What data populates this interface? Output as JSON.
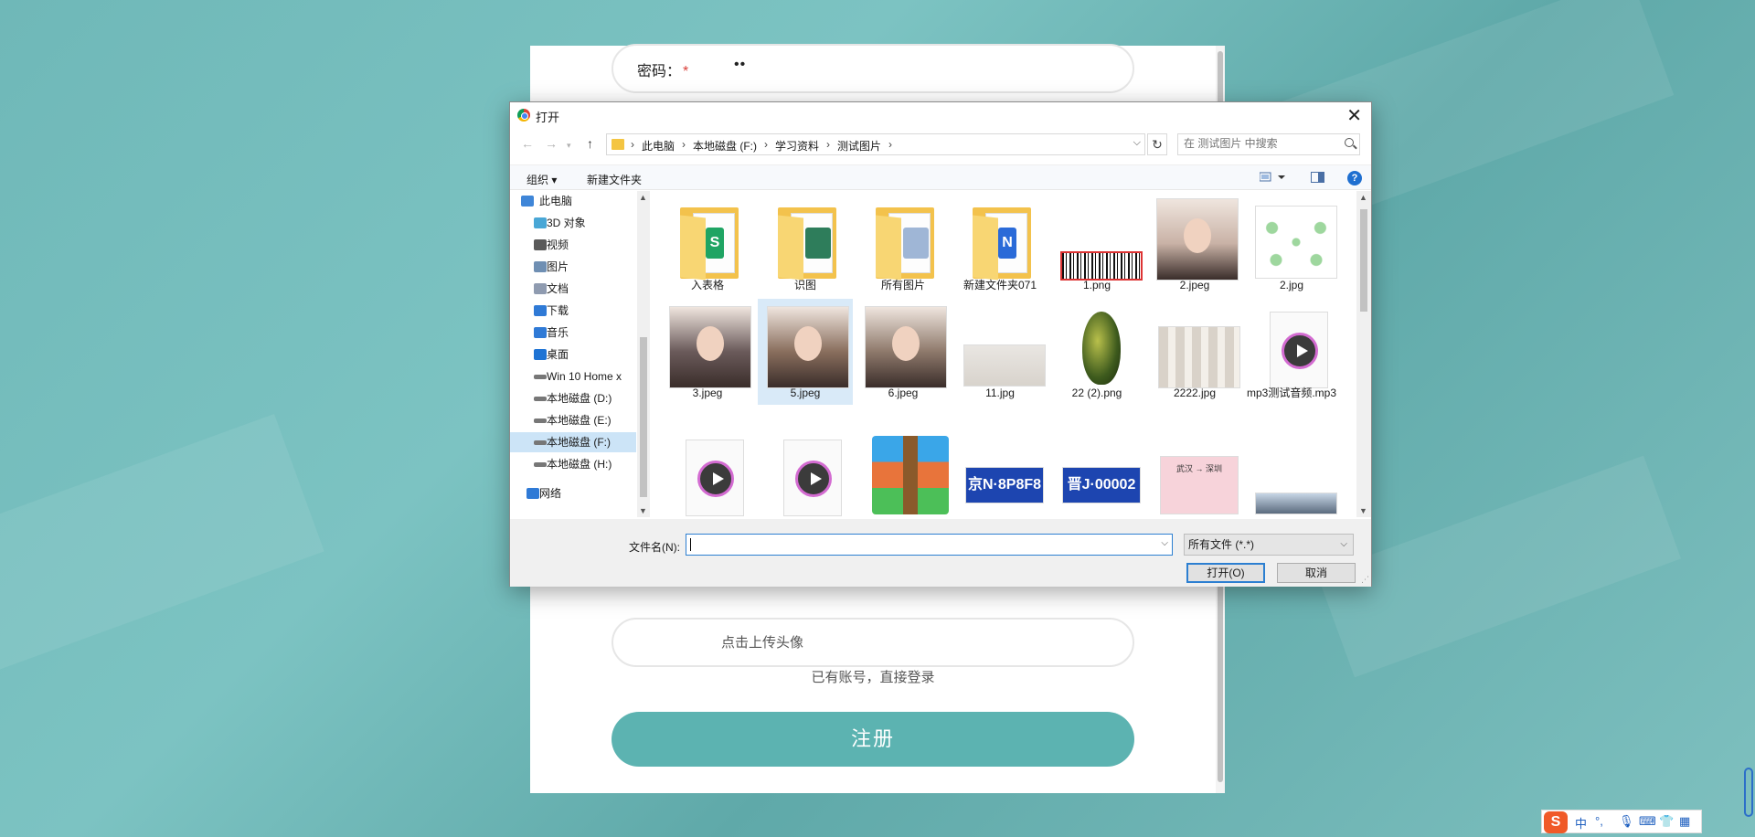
{
  "page": {
    "password_label": "密码：",
    "required_mark": "*",
    "password_value": "••",
    "upload_avatar_text": "点击上传头像",
    "login_link": "已有账号，直接登录",
    "register_button": "注册"
  },
  "dialog": {
    "title": "打开",
    "close_glyph": "✕",
    "breadcrumb": [
      "此电脑",
      "本地磁盘 (F:)",
      "学习资料",
      "测试图片"
    ],
    "search_placeholder": "在 测试图片 中搜索",
    "toolbar": {
      "organize": "组织 ▾",
      "new_folder": "新建文件夹"
    },
    "sidebar": [
      {
        "label": "此电脑",
        "icon": "computer-icon"
      },
      {
        "label": "3D 对象",
        "icon": "3d-objects-icon"
      },
      {
        "label": "视频",
        "icon": "video-icon"
      },
      {
        "label": "图片",
        "icon": "pictures-icon"
      },
      {
        "label": "文档",
        "icon": "documents-icon"
      },
      {
        "label": "下载",
        "icon": "download-icon"
      },
      {
        "label": "音乐",
        "icon": "music-icon"
      },
      {
        "label": "桌面",
        "icon": "desktop-icon"
      },
      {
        "label": "Win 10 Home x",
        "icon": "drive-icon"
      },
      {
        "label": "本地磁盘 (D:)",
        "icon": "drive-icon"
      },
      {
        "label": "本地磁盘 (E:)",
        "icon": "drive-icon"
      },
      {
        "label": "本地磁盘 (F:)",
        "icon": "drive-icon",
        "selected": true
      },
      {
        "label": "本地磁盘 (H:)",
        "icon": "drive-icon"
      },
      {
        "label": "网络",
        "icon": "network-icon"
      }
    ],
    "files": [
      {
        "name": "入表格",
        "kind": "folder",
        "badge": "S",
        "badge_color": "#1fa463"
      },
      {
        "name": "识图",
        "kind": "folder",
        "badge": "",
        "badge_color": "#2e7d5b"
      },
      {
        "name": "所有图片",
        "kind": "folder",
        "badge": "",
        "badge_color": "#9fb6d6"
      },
      {
        "name": "新建文件夹071",
        "kind": "folder",
        "badge": "N",
        "badge_color": "#2a6ad8"
      },
      {
        "name": "1.png",
        "kind": "barcode"
      },
      {
        "name": "2.jpeg",
        "kind": "photo",
        "color": "#c9b2a6"
      },
      {
        "name": "2.jpg",
        "kind": "diagram"
      },
      {
        "name": "3.jpeg",
        "kind": "photo",
        "color": "#6b5b5b"
      },
      {
        "name": "5.jpeg",
        "kind": "photo",
        "color": "#8a6f5e",
        "selected": true
      },
      {
        "name": "6.jpeg",
        "kind": "photo",
        "color": "#8f7a6c"
      },
      {
        "name": "11.jpg",
        "kind": "doc-photo"
      },
      {
        "name": "22 (2).png",
        "kind": "beetle"
      },
      {
        "name": "2222.jpg",
        "kind": "bottles"
      },
      {
        "name": "mp3测试音频.mp3",
        "kind": "media"
      },
      {
        "name": "",
        "kind": "media"
      },
      {
        "name": "",
        "kind": "media"
      },
      {
        "name": "",
        "kind": "archive"
      },
      {
        "name": "",
        "kind": "plate",
        "plate_text": "京N·8P8F8"
      },
      {
        "name": "",
        "kind": "plate",
        "plate_text": "晋J·00002"
      },
      {
        "name": "",
        "kind": "ticket",
        "ticket_text": "武汉 → 深圳"
      },
      {
        "name": "",
        "kind": "city"
      }
    ],
    "filename_label": "文件名(N):",
    "filename_value": "",
    "filetype": "所有文件 (*.*)",
    "open_button": "打开(O)",
    "cancel_button": "取消"
  },
  "tray": {
    "ime_logo": "S",
    "ime_mode": "中",
    "punct": "°,",
    "items": [
      "mic-icon",
      "keyboard-icon",
      "shirt-icon",
      "grid-icon"
    ]
  },
  "colors": {
    "accent": "#5cb3b1",
    "dialog_select": "#cce4f7",
    "focus_blue": "#2c7fd1"
  }
}
